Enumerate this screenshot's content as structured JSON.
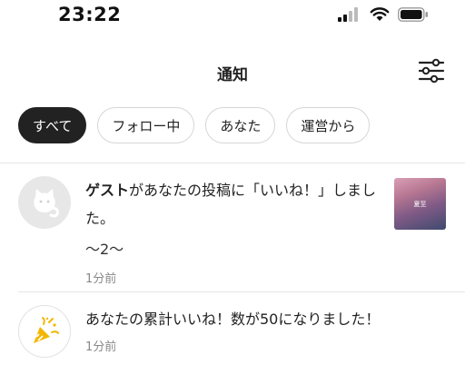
{
  "status_bar": {
    "time": "23:22"
  },
  "header": {
    "title": "通知"
  },
  "tabs": [
    {
      "label": "すべて",
      "active": true
    },
    {
      "label": "フォロー中",
      "active": false
    },
    {
      "label": "あなた",
      "active": false
    },
    {
      "label": "運営から",
      "active": false
    }
  ],
  "notifications": [
    {
      "actor": "ゲスト",
      "message": "があなたの投稿に「いいね！」しました。",
      "subtext": "〜2〜",
      "time": "1分前",
      "thumbnail_text": "夏至"
    },
    {
      "message": "あなたの累計いいね！数が50になりました！",
      "time": "1分前"
    }
  ],
  "colors": {
    "active_tab_bg": "#222222",
    "party_icon": "#f2b705"
  }
}
